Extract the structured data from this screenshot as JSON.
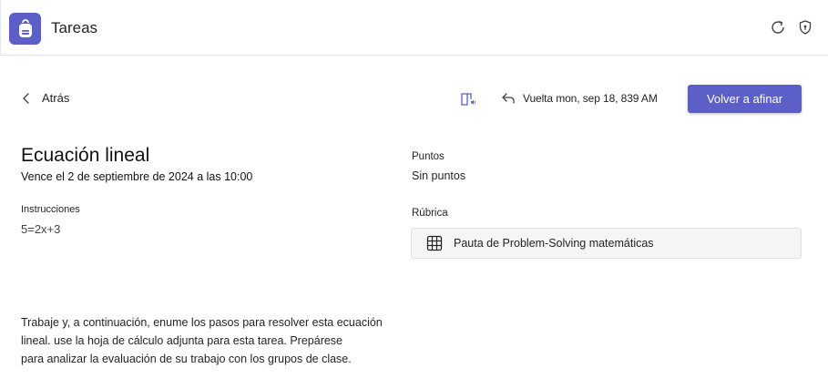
{
  "header": {
    "app_title": "Tareas",
    "app_icon": "backpack-icon",
    "brand_color": "#5b5fc7",
    "actions": [
      {
        "icon": "refresh-icon"
      },
      {
        "icon": "shield-icon"
      }
    ]
  },
  "toolbar": {
    "back_label": "Atrás",
    "reader_icon": "immersive-reader-icon",
    "return_status": "Vuelta mon, sep 18, 839 AM",
    "primary_button_label": "Volver a afinar"
  },
  "assignment": {
    "title": "Ecuación lineal",
    "due": "Vence el 2 de septiembre de 2024 a las 10:00",
    "instructions_label": "Instrucciones",
    "instructions_value": "5=2x+3",
    "body_lines": [
      "Trabaje y, a continuación, enume los pasos para resolver esta ecuación",
      "lineal. use la hoja de cálculo adjunta para esta tarea. Prepárese",
      "para analizar la evaluación de su trabajo con los grupos de clase."
    ]
  },
  "sidebar_info": {
    "points_label": "Puntos",
    "points_value": "Sin puntos",
    "rubric_label": "Rúbrica",
    "rubric_name": "Pauta de Problem-Solving matemáticas",
    "rubric_icon": "table-grid-icon"
  }
}
